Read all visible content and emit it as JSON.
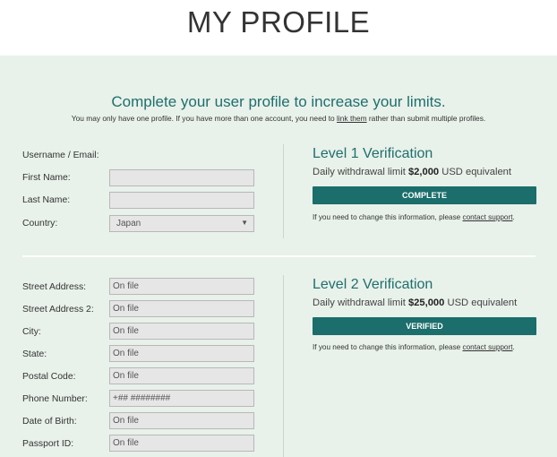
{
  "page": {
    "title": "MY PROFILE"
  },
  "intro": {
    "heading": "Complete your user profile to increase your limits.",
    "sub_before": "You may only have one profile. If you have more than one account, you need to ",
    "sub_link": "link them",
    "sub_after": " rather than submit multiple profiles."
  },
  "basic": {
    "labels": {
      "username": "Username / Email:",
      "first_name": "First Name:",
      "last_name": "Last Name:",
      "country": "Country:"
    },
    "values": {
      "country": "Japan"
    }
  },
  "details": {
    "labels": {
      "street1": "Street Address:",
      "street2": "Street Address 2:",
      "city": "City:",
      "state": "State:",
      "postal": "Postal Code:",
      "phone": "Phone Number:",
      "dob": "Date of Birth:",
      "passport": "Passport ID:"
    },
    "values": {
      "street1": "On file",
      "street2": "On file",
      "city": "On file",
      "state": "On file",
      "postal": "On file",
      "phone": "+## ########",
      "dob": "On file",
      "passport": "On file"
    }
  },
  "level1": {
    "title": "Level 1 Verification",
    "limit_prefix": "Daily withdrawal limit ",
    "limit_amount": "$2,000",
    "limit_suffix": " USD equivalent",
    "status": "COMPLETE",
    "note_before": "If you need to change this information, please ",
    "note_link": "contact support",
    "note_after": "."
  },
  "level2": {
    "title": "Level 2 Verification",
    "limit_prefix": "Daily withdrawal limit ",
    "limit_amount": "$25,000",
    "limit_suffix": " USD equivalent",
    "status": "VERIFIED",
    "note_before": "If you need to change this information, please ",
    "note_link": "contact support",
    "note_after": "."
  },
  "colors": {
    "accent": "#1f6f6d",
    "button": "#1b6e6b",
    "panel_bg": "#e8f1ea"
  },
  "icons": {
    "select_arrow": "chevron-down-icon"
  }
}
